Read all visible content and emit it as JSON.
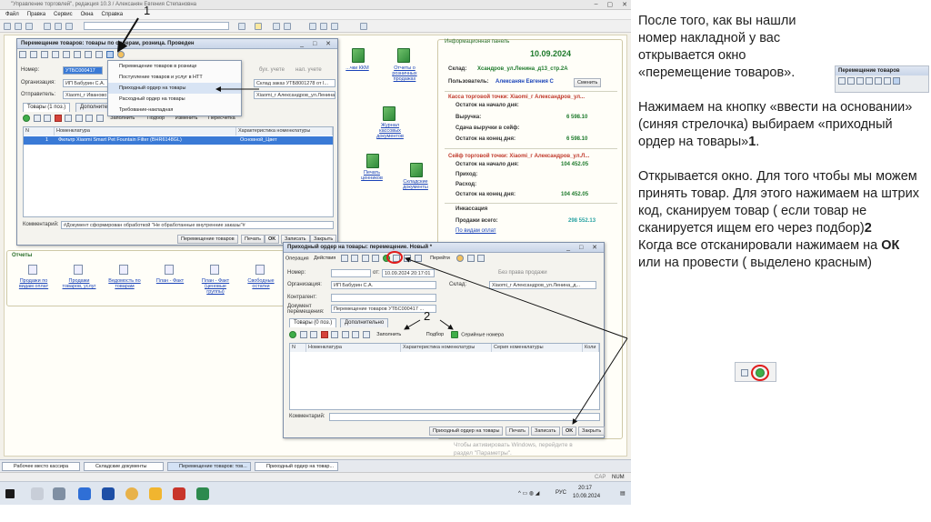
{
  "app": {
    "title": "\"Управление торговлей\", редакция 10.3 / Алексанян Евгения Степановна",
    "menu": [
      "Файл",
      "Правка",
      "Сервис",
      "Окна",
      "Справка"
    ]
  },
  "callouts": {
    "one": "1",
    "two": "2"
  },
  "transfer_doc": {
    "title": "Перемещение товаров: товары по ордерам, розница. Проведен",
    "number_label": "Номер:",
    "number_value": "УТБС000417",
    "org_label": "Организация:",
    "org_value": "ИП Бабурин С.А.",
    "sender_label": "Отправитель:",
    "sender_value": "Xiaomi_г Иваново",
    "chk1": "бух. учете",
    "chk2": "нал. учете",
    "basis_text": "Склад заказ УТБ8001278 от I...",
    "recipient_text": "Xiaomi_г Александров_ул.Ленина_д13 ...",
    "tab_goods": "Товары (1 поз.)",
    "tab_more": "Дополнительно",
    "toolbar": {
      "fill": "Заполнить",
      "pick": "Подбор",
      "change": "Изменить",
      "recount": "Пересчетка"
    },
    "table_headers": [
      "N",
      "Номенклатура",
      "Характеристика номенклатуры"
    ],
    "rows": [
      {
        "n": "1",
        "item": "Фильтр Xiaomi Smart Pet Fountain Filter (BHR6148GL)",
        "char": "Основной_Цвет"
      }
    ],
    "comment_label": "Комментарий:",
    "comment_value": "#Документ сформирован обработкой \"Не обработанные внутренние заказы\"#",
    "footer": {
      "print_doc": "Перемещение товаров",
      "print": "Печать",
      "ok": "OK",
      "save": "Записать",
      "close": "Закрыть"
    }
  },
  "basis_menu": {
    "items": [
      "Перемещение товаров в рознице",
      "Поступление товаров и услуг в НТТ",
      "Приходный ордер на товары",
      "Расходный ордер на товары",
      "Требование-накладная"
    ],
    "selected_index": 2
  },
  "receipt_doc": {
    "title": "Приходный ордер на товары: перемещение. Новый *",
    "menu": {
      "operation": "Операция",
      "actions": "Действия",
      "goto": "Перейти"
    },
    "number_label": "Номер:",
    "from_label": "от:",
    "date_value": "10.09.2024 20:17:01",
    "no_sale_right": "Без права продажи",
    "org_label": "Организация:",
    "org_value": "ИП Бабурин С.А.",
    "warehouse_label": "Склад:",
    "warehouse_value": "Xiaomi_г Александров_ул.Ленина_д...",
    "contractor_label": "Контрагент:",
    "doc_label": "Документ перемещения:",
    "doc_value": "Перемещение товаров УТБС000417 ...",
    "tab_goods": "Товары (0 поз.)",
    "tab_more": "Дополнительно",
    "toolbar": {
      "fill": "Заполнить",
      "pick": "Подбор",
      "serials": "Серийные номера"
    },
    "table_headers": [
      "N",
      "Номенклатура",
      "Характеристика номенклатуры",
      "Серия номенклатуры",
      "Коли"
    ],
    "comment_label": "Комментарий:",
    "footer": {
      "print_doc": "Приходный ордер на товары",
      "print": "Печать",
      "save": "Записать",
      "ok": "OK",
      "close": "Закрыть"
    }
  },
  "info_panel": {
    "title": "Информационная панель",
    "date": "10.09.2024",
    "warehouse_label": "Склад:",
    "warehouse_value": "Xсандров_ул.Ленина_д13_стр.2А",
    "user_label": "Пользователь:",
    "user_value": "Алексанян Евгения С",
    "change_btn": "Сменить",
    "cash_header": "Касса торговой точки: Xiaomi_г Александров_ул...",
    "cash_rows": [
      {
        "label": "Остаток на начало дня:",
        "value": ""
      },
      {
        "label": "Выручка:",
        "value": "6 598.10"
      },
      {
        "label": "Сдача выручки в сейф:",
        "value": ""
      },
      {
        "label": "Остаток на конец дня:",
        "value": "6 598.10"
      }
    ],
    "safe_header": "Сейф торговой точки: Xiaomi_г Александров_ул.Л...",
    "safe_rows": [
      {
        "label": "Остаток на начало дня:",
        "value": "104 452.05"
      },
      {
        "label": "Приход:",
        "value": ""
      },
      {
        "label": "Расход:",
        "value": ""
      },
      {
        "label": "Остаток на конец дня:",
        "value": "104 452.05"
      }
    ],
    "collection_label": "Инкассация",
    "sales_label": "Продажи всего:",
    "sales_value": "298 552.13",
    "not_paid": "По видам оплат"
  },
  "desktop_links": {
    "journal_kkm": "...чки ККМ",
    "reports_retail": "Отчеты о розничных продажах",
    "cash_journal": "Журнал кассовых документов",
    "print_tags": "Печать ценников",
    "warehouse_docs": "Складские документы"
  },
  "reports": {
    "title": "Отчеты",
    "items": [
      "Продажи по видам оплат",
      "Продажи товаров, услуг",
      "Ведомость по товарам",
      "План - Факт",
      "План - Факт (ценовые группы)",
      "Свободные остатки"
    ]
  },
  "activation": {
    "line1": "Чтобы активировать Windows, перейдите в",
    "line2": "раздел \"Параметры\"."
  },
  "window_tabs": [
    "Рабочее место кассира",
    "Складские документы",
    "Перемещение товаров: тов...",
    "Приходный ордер на товар..."
  ],
  "status": {
    "cap": "CAP",
    "num": "NUM"
  },
  "os_taskbar": {
    "lang": "РУС",
    "time": "20:17",
    "date": "10.09.2024"
  },
  "instruction": {
    "p1": "После того, как вы нашли номер накладной у вас открывается окно «перемещение товаров».",
    "p2a": "Нажимаем на кнопку «ввести на основании» (синяя стрелочка) выбираем «приходный ордер на товары»",
    "p2b": "1",
    "p2c": ".",
    "p3a": "Открывается окно. Для того чтобы мы можем принять товар. Для этого нажимаем на штрих код, сканируем товар ( если товар не сканируется ищем его через подбор)",
    "p3b": "2",
    "p4a": "Когда все отсканировали нажимаем на ",
    "p4b": "ОК",
    "p4c": " или на провести ( выделено красным)",
    "thumb_title": "Перемещение товаров"
  }
}
